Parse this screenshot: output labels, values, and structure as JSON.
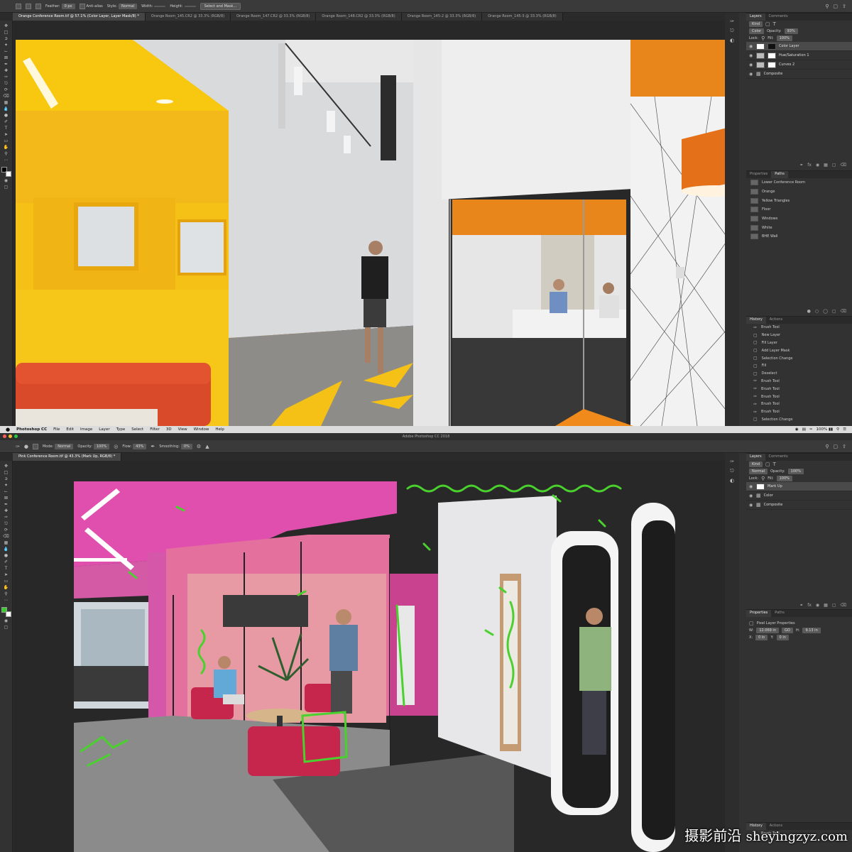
{
  "top_window": {
    "options": [
      {
        "label": "Feather:",
        "value": "0 px"
      },
      {
        "label": "Anti-alias",
        "value": ""
      },
      {
        "label": "Style:",
        "value": "Normal"
      },
      {
        "label": "Width:",
        "value": ""
      },
      {
        "label": "Height:",
        "value": ""
      }
    ],
    "select_mask_button": "Select and Mask...",
    "tabs": [
      "Orange Conference Room.tif @ 57.1% (Color Layer, Layer Mask/8) *",
      "Orange Room_145.CR2 @ 33.3% (RGB/8)",
      "Orange Room_147.CR2 @ 33.3% (RGB/8)",
      "Orange Room_148.CR2 @ 33.3% (RGB/8)",
      "Orange Room_145-2 @ 33.3% (RGB/8)",
      "Orange Room_145-3 @ 33.3% (RGB/8)"
    ],
    "layers_panel": {
      "tabs": [
        "Layers",
        "Comments"
      ],
      "kind": "Kind",
      "blend_mode": "Color",
      "opacity_label": "Opacity:",
      "opacity": "93%",
      "lock_label": "Lock:",
      "fill_label": "Fill:",
      "fill": "100%",
      "layers": [
        {
          "name": "Color Layer",
          "selected": true
        },
        {
          "name": "Hue/Saturation 1",
          "selected": false
        },
        {
          "name": "Curves 2",
          "selected": false
        },
        {
          "name": "Composite",
          "selected": false
        }
      ]
    },
    "paths_panel": {
      "tabs": [
        "Properties",
        "Paths"
      ],
      "items": [
        "Lower Conference Room",
        "Orange",
        "Yellow Triangles",
        "Floor",
        "Windows",
        "White",
        "BHE Wall"
      ]
    },
    "history_panel": {
      "tabs": [
        "History",
        "Actions"
      ],
      "items": [
        "Brush Tool",
        "New Layer",
        "Fill Layer",
        "Add Layer Mask",
        "Selection Change",
        "Fill",
        "Deselect",
        "Brush Tool",
        "Brush Tool",
        "Brush Tool",
        "Brush Tool",
        "Brush Tool",
        "Selection Change"
      ]
    }
  },
  "menubar": {
    "app": "Photoshop CC",
    "items": [
      "File",
      "Edit",
      "Image",
      "Layer",
      "Type",
      "Select",
      "Filter",
      "3D",
      "View",
      "Window",
      "Help"
    ],
    "status": "100% ▮▮"
  },
  "bottom_window": {
    "title": "Adobe Photoshop CC 2018",
    "options": [
      {
        "label": "Mode:",
        "value": "Normal"
      },
      {
        "label": "Opacity:",
        "value": "100%"
      },
      {
        "label": "Flow:",
        "value": "43%"
      },
      {
        "label": "Smoothing:",
        "value": "0%"
      }
    ],
    "tab": "Pink Conference Room.tif @ 43.3% (Mark Up, RGB/8) *",
    "layers_panel": {
      "tabs": [
        "Layers",
        "Comments"
      ],
      "kind": "Kind",
      "blend_mode": "Normal",
      "opacity_label": "Opacity:",
      "opacity": "100%",
      "lock_label": "Lock:",
      "fill_label": "Fill:",
      "fill": "100%",
      "layers": [
        {
          "name": "Mark Up",
          "selected": true
        },
        {
          "name": "Color",
          "selected": false
        },
        {
          "name": "Composite",
          "selected": false
        }
      ]
    },
    "properties_panel": {
      "tabs": [
        "Properties",
        "Paths"
      ],
      "title": "Pixel Layer Properties",
      "w_label": "W:",
      "w_value": "12.069 in",
      "h_label": "H:",
      "h_value": "9.13 in",
      "x_label": "X:",
      "x_value": "0 in",
      "y_label": "Y:",
      "y_value": "0 in",
      "go_label": "GO"
    },
    "history_panel": {
      "tabs": [
        "History",
        "Actions"
      ],
      "items": [
        "Brush Tool"
      ]
    }
  },
  "watermark": {
    "cn": "摄影前沿",
    "url": "sheyingzyz.com"
  },
  "colors": {
    "panel_bg": "#323232",
    "orange": "#e8861a",
    "yellow": "#f5c116",
    "pink": "#de5bb6",
    "markup_green": "#4ad12e",
    "sofa_red": "#d94a2b"
  }
}
